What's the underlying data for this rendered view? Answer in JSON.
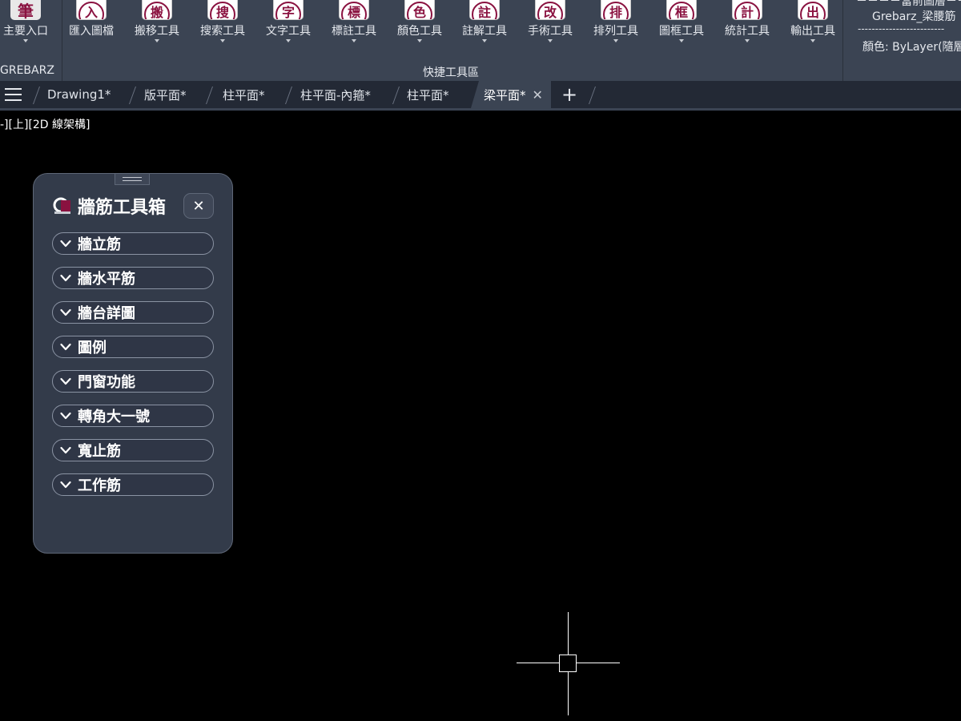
{
  "ribbon": {
    "main_entry": {
      "label": "主要入口",
      "logo_glyph": "筆"
    },
    "tools": [
      {
        "label": "匯入圖檔",
        "glyph": "入",
        "has_dropdown": false
      },
      {
        "label": "搬移工具",
        "glyph": "搬",
        "has_dropdown": true
      },
      {
        "label": "搜索工具",
        "glyph": "搜",
        "has_dropdown": true
      },
      {
        "label": "文字工具",
        "glyph": "字",
        "has_dropdown": true
      },
      {
        "label": "標註工具",
        "glyph": "標",
        "has_dropdown": true
      },
      {
        "label": "顏色工具",
        "glyph": "色",
        "has_dropdown": true
      },
      {
        "label": "註解工具",
        "glyph": "註",
        "has_dropdown": true
      },
      {
        "label": "手術工具",
        "glyph": "改",
        "has_dropdown": true
      },
      {
        "label": "排列工具",
        "glyph": "排",
        "has_dropdown": true
      },
      {
        "label": "圖框工具",
        "glyph": "框",
        "has_dropdown": true
      },
      {
        "label": "統計工具",
        "glyph": "計",
        "has_dropdown": true
      },
      {
        "label": "輸出工具",
        "glyph": "出",
        "has_dropdown": true
      }
    ],
    "group_grebarz": "GREBARZ",
    "group_quick": "快捷工具區",
    "layer_panel": {
      "header": "－－－－當前圖層－－－",
      "layer_name": "Grebarz_梁腰筋",
      "divider": "-------------------------",
      "color": "顏色: ByLayer(隨層"
    },
    "accent_color": "#8a1240"
  },
  "tabs": [
    {
      "label": "Drawing1*",
      "active": false
    },
    {
      "label": "版平面*",
      "active": false
    },
    {
      "label": "柱平面*",
      "active": false
    },
    {
      "label": "柱平面-內箍*",
      "active": false
    },
    {
      "label": "柱平面*",
      "active": false
    },
    {
      "label": "梁平面*",
      "active": true
    }
  ],
  "tab_add_label": "+",
  "tab_close_label": "✕",
  "viewport_label": "-][上][2D 線架構]",
  "palette": {
    "title": "牆筋工具箱",
    "close_label": "✕",
    "sections": [
      {
        "label": "牆立筋"
      },
      {
        "label": "牆水平筋"
      },
      {
        "label": "牆台詳圖"
      },
      {
        "label": "圖例"
      },
      {
        "label": "門窗功能"
      },
      {
        "label": "轉角大一號"
      },
      {
        "label": "寬止筋"
      },
      {
        "label": "工作筋"
      }
    ]
  }
}
